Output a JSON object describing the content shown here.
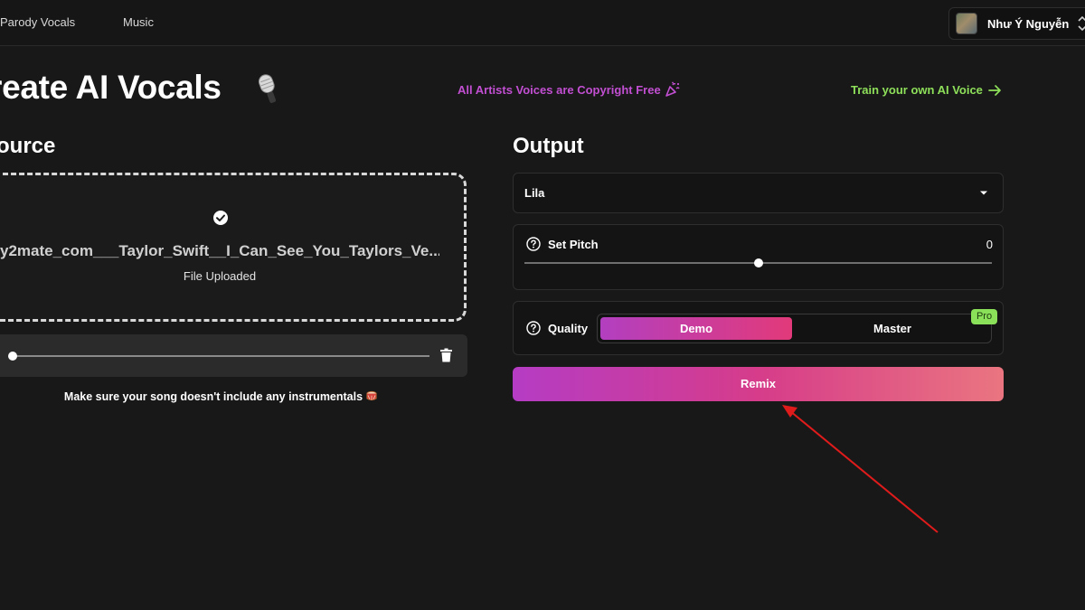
{
  "nav": {
    "items": [
      {
        "label": "Parody Vocals"
      },
      {
        "label": "Music"
      }
    ],
    "user": {
      "name": "Như Ý Nguyễn"
    }
  },
  "header": {
    "title": "reate AI Vocals",
    "copyright_note": "All Artists Voices are Copyright Free",
    "train_link": "Train your own AI Voice"
  },
  "source": {
    "title": "ource",
    "file_name": "y2mate_com___Taylor_Swift__I_Can_See_You_Taylors_Ve...",
    "file_status": "File Uploaded",
    "player_progress": 0,
    "note": "Make sure your song doesn't include any instrumentals"
  },
  "output": {
    "title": "Output",
    "voice": {
      "selected": "Lila"
    },
    "pitch": {
      "label": "Set Pitch",
      "value": "0",
      "level": 0.5
    },
    "quality": {
      "label": "Quality",
      "options": [
        {
          "label": "Demo",
          "selected": true
        },
        {
          "label": "Master",
          "selected": false
        }
      ],
      "pro_badge": "Pro"
    },
    "remix_label": "Remix"
  },
  "colors": {
    "background": "#181818",
    "accent_purple": "#c24fd2",
    "accent_green": "#8ee05a",
    "gradient_start": "#b53cc4",
    "gradient_end": "#ea7580",
    "annotation_red": "#e01b1b"
  },
  "icons": [
    "avatar",
    "chevron-updown-icon",
    "microphone-icon",
    "party-popper-icon",
    "arrow-right-icon",
    "check-circle-icon",
    "trash-icon",
    "drum-icon",
    "caret-down-icon",
    "help-circle-icon",
    "annotation-arrow"
  ]
}
